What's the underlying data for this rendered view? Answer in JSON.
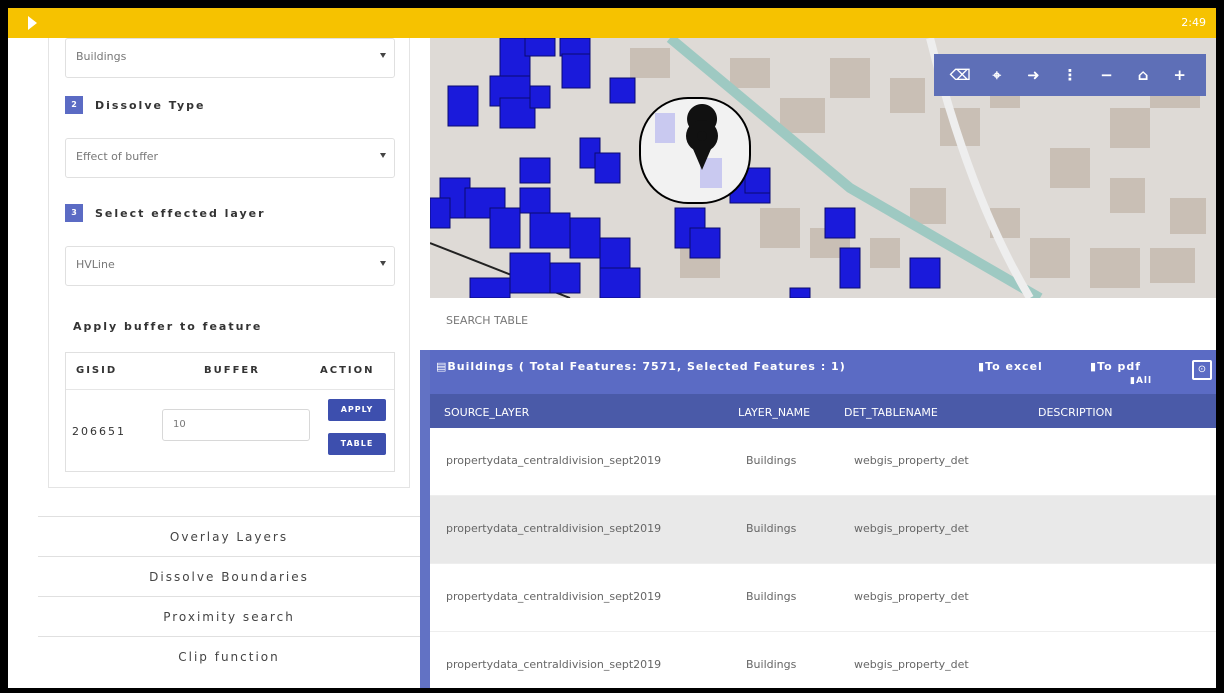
{
  "status_bar": {
    "time": "2:49"
  },
  "left_panel": {
    "layer_select_value": "Buildings",
    "step2": {
      "num": "2",
      "label": "Dissolve Type"
    },
    "dissolve_select_value": "Effect of buffer",
    "step3": {
      "num": "3",
      "label": "Select effected layer"
    },
    "effected_select_value": "HVLine",
    "apply_buffer_label": "Apply buffer to feature",
    "buffer_table": {
      "headers": [
        "GISID",
        "BUFFER",
        "ACTION"
      ],
      "gisid": "206651",
      "buffer_value": "10",
      "apply_label": "APPLY",
      "table_label": "TABLE"
    },
    "accordion": [
      "Overlay Layers",
      "Dissolve Boundaries",
      "Proximity search",
      "Clip function"
    ]
  },
  "map": {
    "toolbar_icons": [
      "eraser-icon",
      "marker-icon",
      "sign-out-icon",
      "more-icon",
      "zoom-out-icon",
      "home-icon",
      "zoom-in-icon"
    ]
  },
  "table_panel": {
    "search_label": "SEARCH TABLE",
    "title": "Buildings ( Total Features: 7571, Selected Features : 1)",
    "to_excel": "To excel",
    "to_pdf": "To pdf",
    "all": "All",
    "columns": [
      "SOURCE_LAYER",
      "LAYER_NAME",
      "DET_TABLENAME",
      "DESCRIPTION"
    ],
    "rows": [
      [
        "propertydata_centraldivision_sept2019",
        "Buildings",
        "webgis_property_det",
        ""
      ],
      [
        "propertydata_centraldivision_sept2019",
        "Buildings",
        "webgis_property_det",
        ""
      ],
      [
        "propertydata_centraldivision_sept2019",
        "Buildings",
        "webgis_property_det",
        ""
      ],
      [
        "propertydata_centraldivision_sept2019",
        "Buildings",
        "webgis_property_det",
        ""
      ]
    ]
  },
  "colors": {
    "accent": "#5b6bc4",
    "topbar": "#f6c200",
    "building": "#1a1adb"
  }
}
